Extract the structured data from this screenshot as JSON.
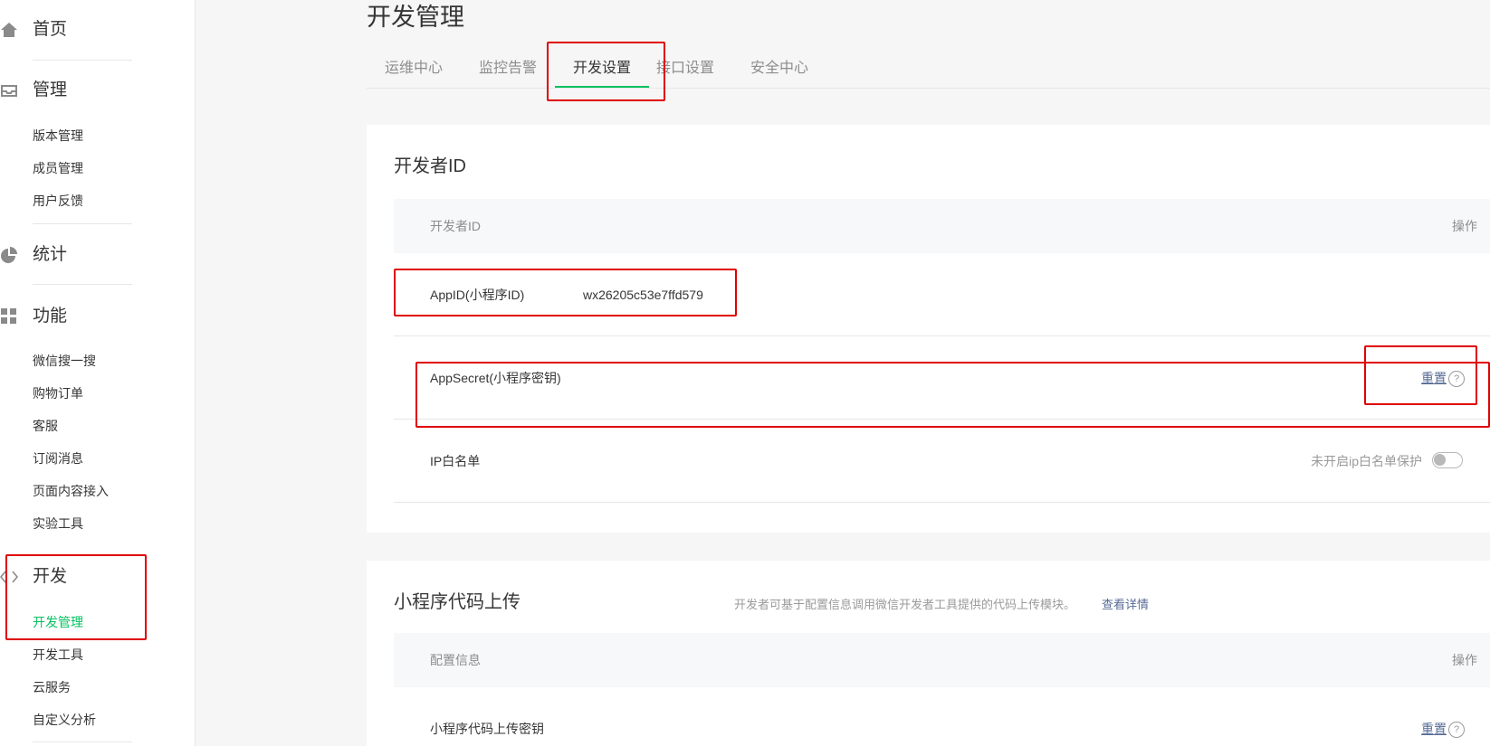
{
  "sidebar": {
    "home_label": "首页",
    "manage_label": "管理",
    "manage_items": [
      "版本管理",
      "成员管理",
      "用户反馈"
    ],
    "stats_label": "统计",
    "features_label": "功能",
    "feature_items": [
      "微信搜一搜",
      "购物订单",
      "客服",
      "订阅消息",
      "页面内容接入",
      "实验工具"
    ],
    "dev_label": "开发",
    "dev_items": [
      "开发管理",
      "开发工具",
      "云服务",
      "自定义分析"
    ]
  },
  "page": {
    "title": "开发管理",
    "tabs": [
      "运维中心",
      "监控告警",
      "开发设置",
      "接口设置",
      "安全中心"
    ]
  },
  "developer_id": {
    "title": "开发者ID",
    "col_name": "开发者ID",
    "col_action": "操作",
    "appid_label": "AppID(小程序ID)",
    "appid_value": "wx26205c53e7ffd579",
    "secret_label": "AppSecret(小程序密钥)",
    "secret_action": "重置",
    "ip_label": "IP白名单",
    "ip_status": "未开启ip白名单保护"
  },
  "code_upload": {
    "title": "小程序代码上传",
    "desc": "开发者可基于配置信息调用微信开发者工具提供的代码上传模块。",
    "desc_link": "查看详情",
    "col_name": "配置信息",
    "col_action": "操作",
    "key_label": "小程序代码上传密钥",
    "key_action": "重置"
  },
  "colors": {
    "accent": "#07c160",
    "link": "#576b95",
    "highlight": "#e00000"
  }
}
